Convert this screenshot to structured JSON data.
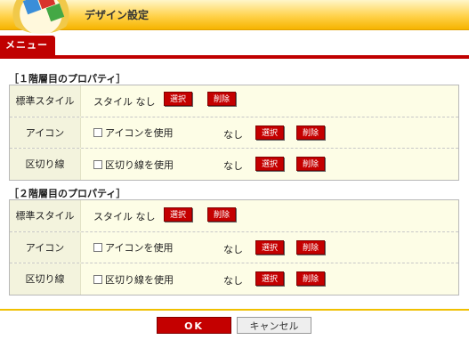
{
  "window": {
    "title": "デザイン設定"
  },
  "menu": {
    "tab_label": "メニュー"
  },
  "sections": [
    {
      "title": "［１階層目のプロパティ］",
      "rows": [
        {
          "label": "標準スタイル",
          "text": "スタイル なし",
          "select_label": "選択",
          "delete_label": "削除"
        },
        {
          "label": "アイコン",
          "checkbox_label": "アイコンを使用",
          "value": "なし",
          "select_label": "選択",
          "delete_label": "削除"
        },
        {
          "label": "区切り線",
          "checkbox_label": "区切り線を使用",
          "value": "なし",
          "select_label": "選択",
          "delete_label": "削除"
        }
      ]
    },
    {
      "title": "［２階層目のプロパティ］",
      "rows": [
        {
          "label": "標準スタイル",
          "text": "スタイル なし",
          "select_label": "選択",
          "delete_label": "削除"
        },
        {
          "label": "アイコン",
          "checkbox_label": "アイコンを使用",
          "value": "なし",
          "select_label": "選択",
          "delete_label": "削除"
        },
        {
          "label": "区切り線",
          "checkbox_label": "区切り線を使用",
          "value": "なし",
          "select_label": "選択",
          "delete_label": "削除"
        }
      ]
    }
  ],
  "footer": {
    "ok_label": "OK",
    "cancel_label": "キャンセル"
  },
  "colors": {
    "accent_red": "#c00000",
    "header_yellow": "#ffd24a",
    "panel_bg": "#fdfde6"
  }
}
